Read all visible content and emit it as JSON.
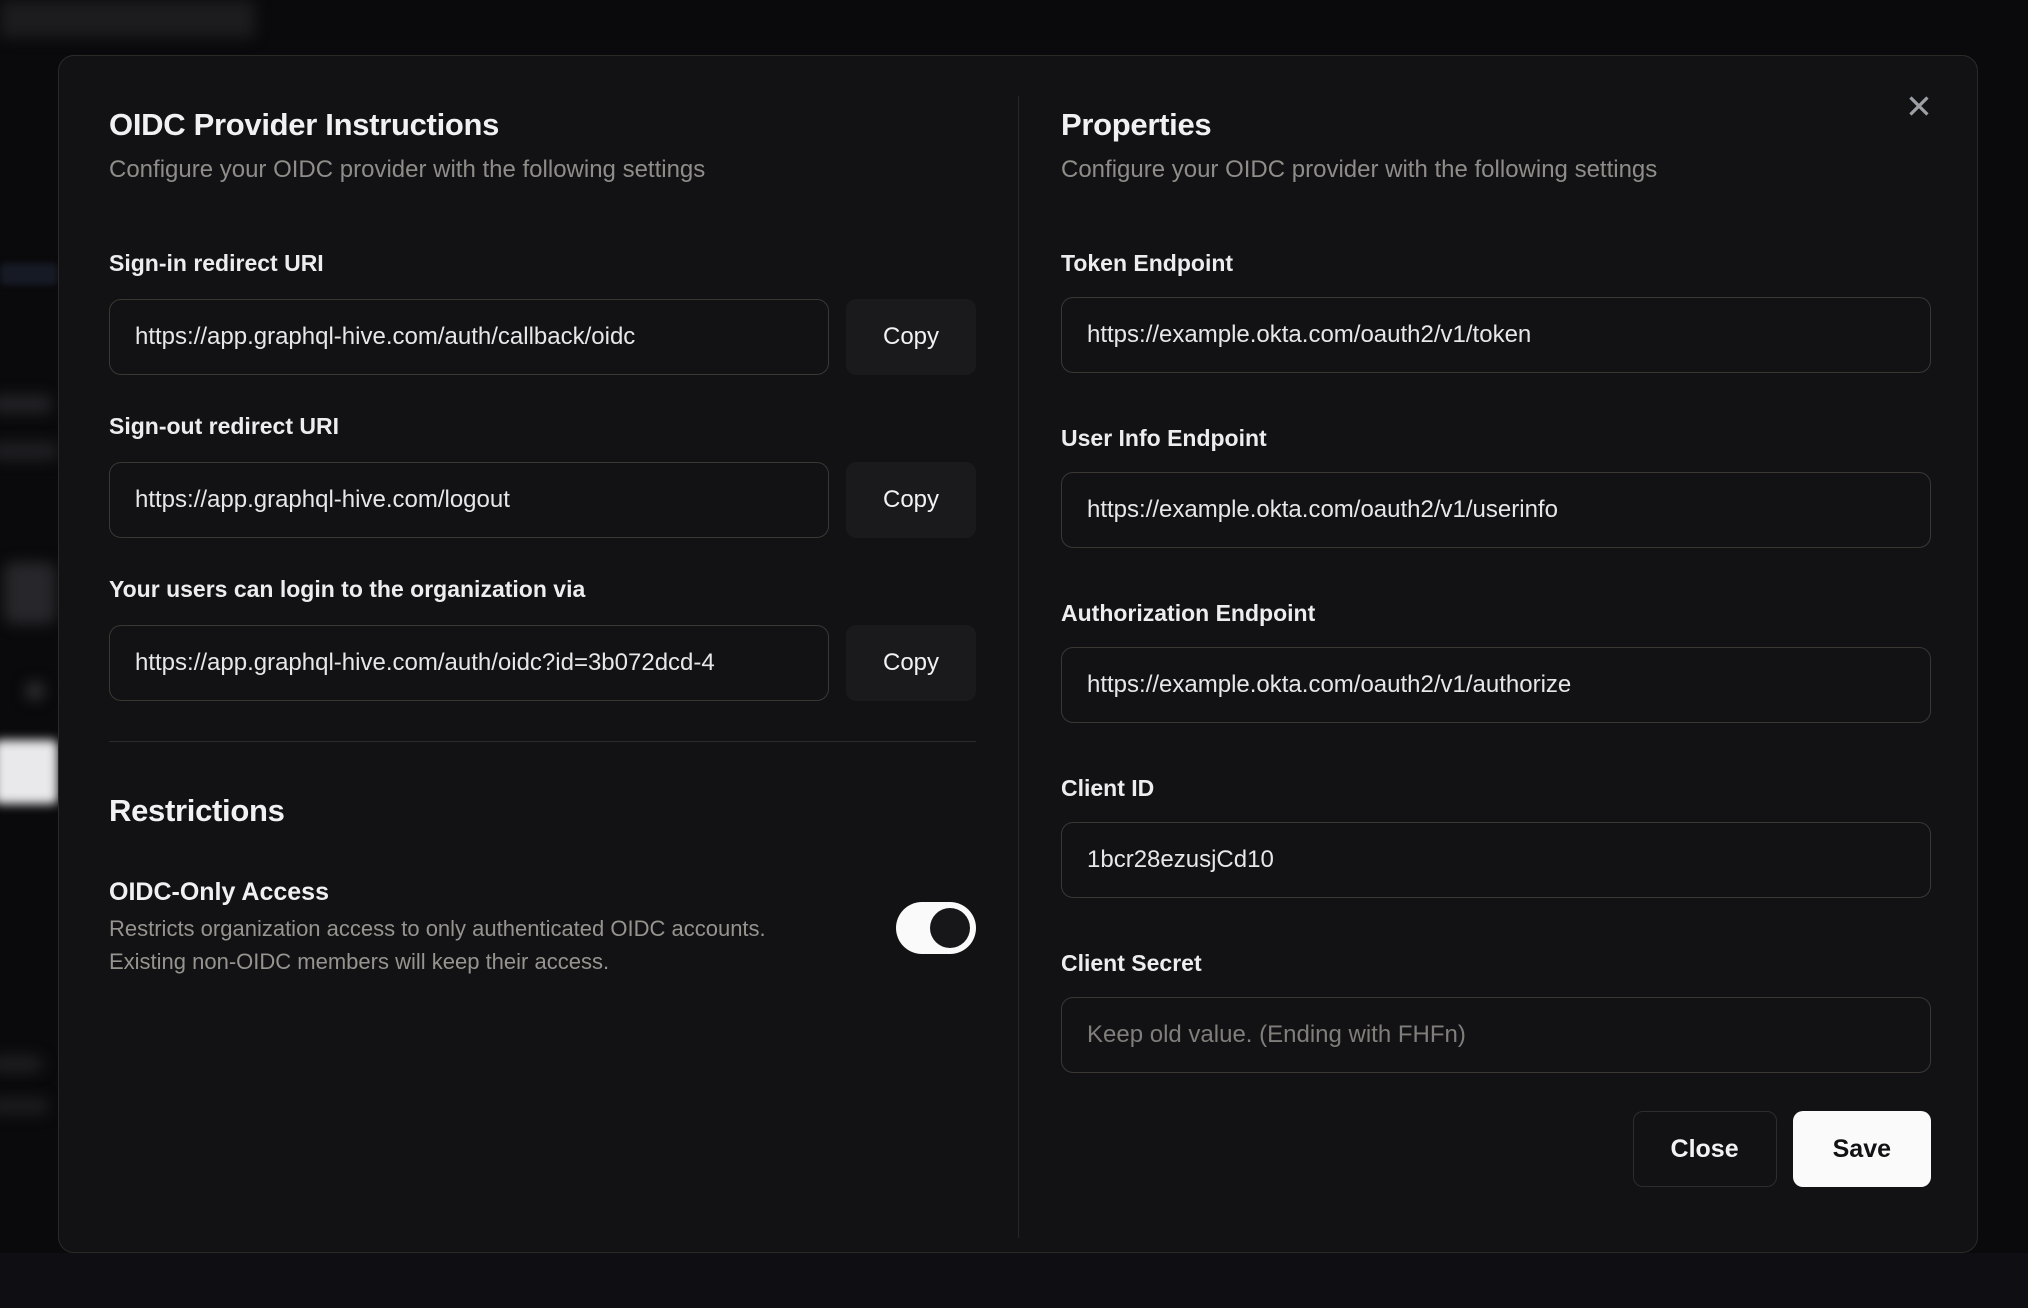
{
  "modal": {
    "close_icon": "✕",
    "left": {
      "title": "OIDC Provider Instructions",
      "subtitle": "Configure your OIDC provider with the following settings",
      "fields": [
        {
          "label": "Sign-in redirect URI",
          "value": "https://app.graphql-hive.com/auth/callback/oidc",
          "copy_label": "Copy"
        },
        {
          "label": "Sign-out redirect URI",
          "value": "https://app.graphql-hive.com/logout",
          "copy_label": "Copy"
        },
        {
          "label": "Your users can login to the organization via",
          "value": "https://app.graphql-hive.com/auth/oidc?id=3b072dcd-4",
          "copy_label": "Copy"
        }
      ],
      "restrictions": {
        "title": "Restrictions",
        "toggle_label": "OIDC-Only Access",
        "toggle_description_line1": "Restricts organization access to only authenticated OIDC accounts.",
        "toggle_description_line2": "Existing non-OIDC members will keep their access.",
        "toggle_state": "on"
      }
    },
    "right": {
      "title": "Properties",
      "subtitle": "Configure your OIDC provider with the following settings",
      "fields": [
        {
          "label": "Token Endpoint",
          "value": "https://example.okta.com/oauth2/v1/token"
        },
        {
          "label": "User Info Endpoint",
          "value": "https://example.okta.com/oauth2/v1/userinfo"
        },
        {
          "label": "Authorization Endpoint",
          "value": "https://example.okta.com/oauth2/v1/authorize"
        },
        {
          "label": "Client ID",
          "value": "1bcr28ezusjCd10"
        },
        {
          "label": "Client Secret",
          "value": "",
          "placeholder": "Keep old value. (Ending with FHFn)"
        }
      ],
      "buttons": {
        "close": "Close",
        "save": "Save"
      }
    }
  },
  "colors": {
    "page_bg": "#0a0a0c",
    "modal_bg": "#121214",
    "input_border": "#3b3732",
    "text_primary": "#ececee",
    "text_muted": "#8f8d89",
    "toggle_on_track": "#fafafa",
    "save_button_bg": "#fafafa"
  }
}
